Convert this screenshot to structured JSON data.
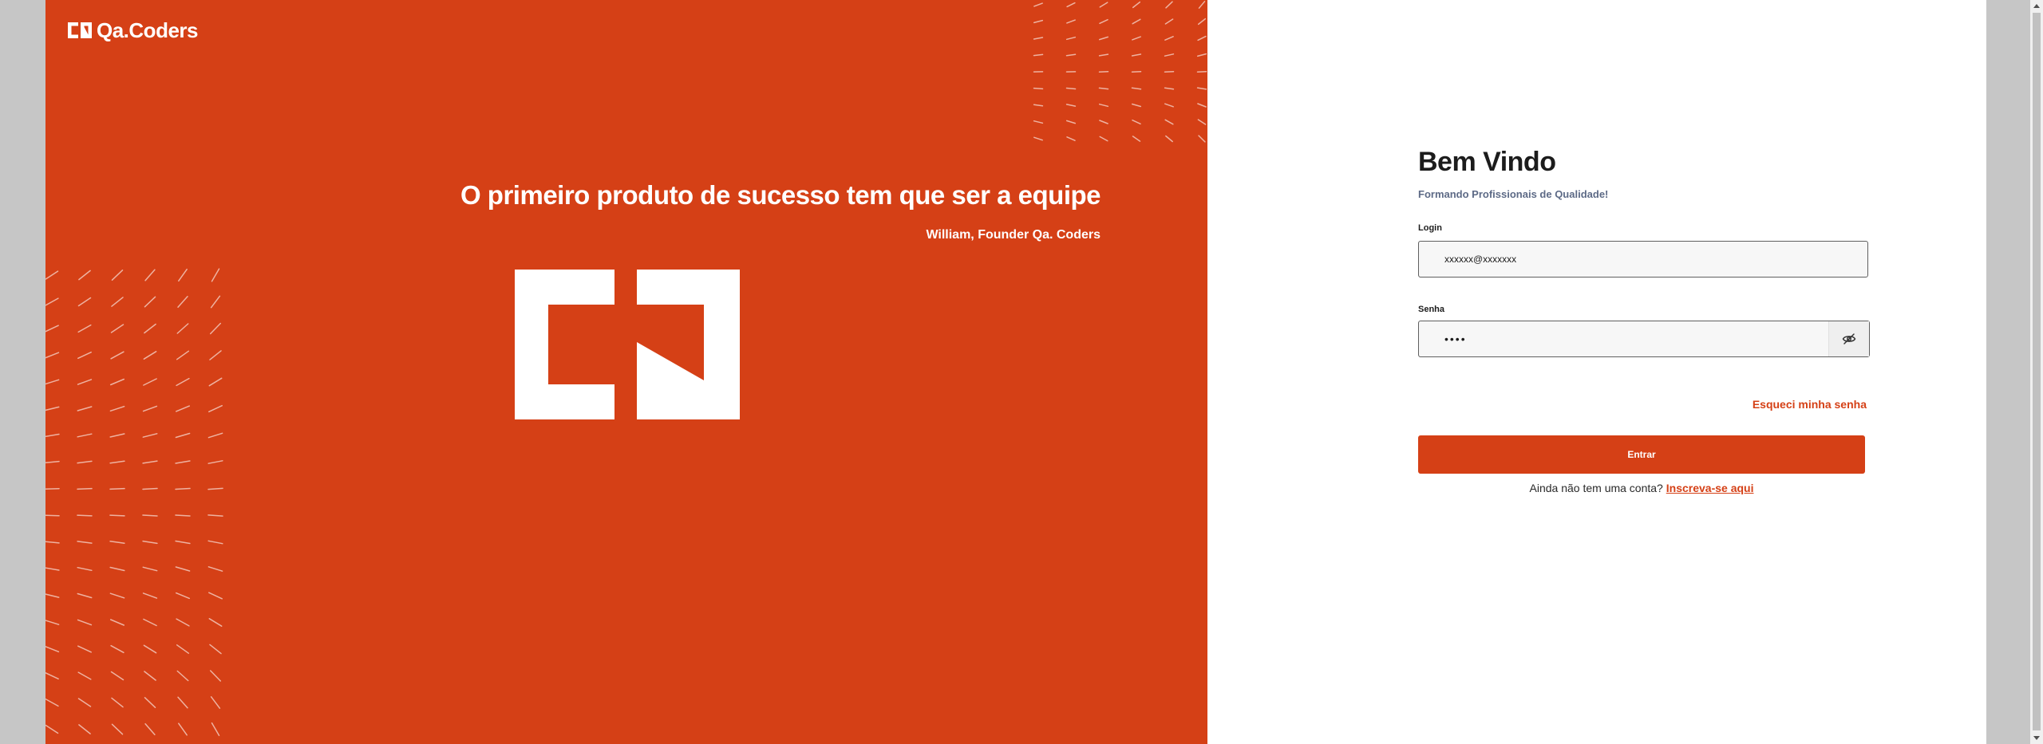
{
  "brand": {
    "name": "Qa.Coders"
  },
  "hero": {
    "headline": "O primeiro produto de sucesso tem que ser a equipe",
    "quote": "William, Founder Qa. Coders"
  },
  "login": {
    "title": "Bem Vindo",
    "subtitle": "Formando Profissionais de Qualidade!",
    "login_label": "Login",
    "login_value": "xxxxxx@xxxxxxx",
    "password_label": "Senha",
    "password_value": "****",
    "forgot_label": "Esqueci minha senha",
    "submit_label": "Entrar",
    "signup_prompt": "Ainda não tem uma conta?",
    "signup_link": "Inscreva-se aqui"
  },
  "icons": {
    "brand": "qacoders-logo-icon",
    "password_toggle": "eye-off-icon"
  },
  "colors": {
    "accent": "#d54016",
    "hero_background": "#d54016",
    "subtitle": "#5d6a86",
    "page_background": "#ffffff"
  }
}
